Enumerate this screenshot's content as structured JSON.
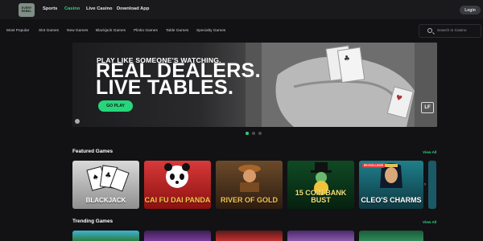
{
  "header": {
    "logo_line1": "EVERY",
    "logo_line2": "REBEL",
    "nav": [
      "Sports",
      "Casino",
      "Live Casino",
      "Download App"
    ],
    "active_nav": "Casino",
    "login_label": "Login"
  },
  "categories": [
    "Most Popular",
    "Slot Games",
    "New Games",
    "Blackjack Games",
    "Plinko Games",
    "Table Games",
    "Specialty Games"
  ],
  "search": {
    "placeholder": "Search in Casino"
  },
  "hero": {
    "kicker": "PLAY LIKE SOMEONE'S WATCHING.",
    "line1": "REAL DEALERS.",
    "line2": "LIVE TABLES.",
    "cta": "GO PLAY",
    "side_text": "",
    "badge_text": "LF"
  },
  "carousel": {
    "count": 3,
    "active": 0
  },
  "featured": {
    "title": "Featured Games",
    "view_all": "View All",
    "games": [
      {
        "title": "BLACKJACK",
        "tag": ""
      },
      {
        "title": "CAI FU DAI PANDA",
        "tag": ""
      },
      {
        "title": "RIVER OF GOLD",
        "tag": ""
      },
      {
        "title": "15 COIN BANK BUST",
        "tag": ""
      },
      {
        "title": "CLEO'S CHARMS",
        "tag": "ER EXCLUSIVE"
      }
    ]
  },
  "trending": {
    "title": "Trending Games",
    "view_all": "View All"
  },
  "colors": {
    "accent": "#27d67a",
    "background": "#121215",
    "topbar": "#1a1a1d"
  }
}
